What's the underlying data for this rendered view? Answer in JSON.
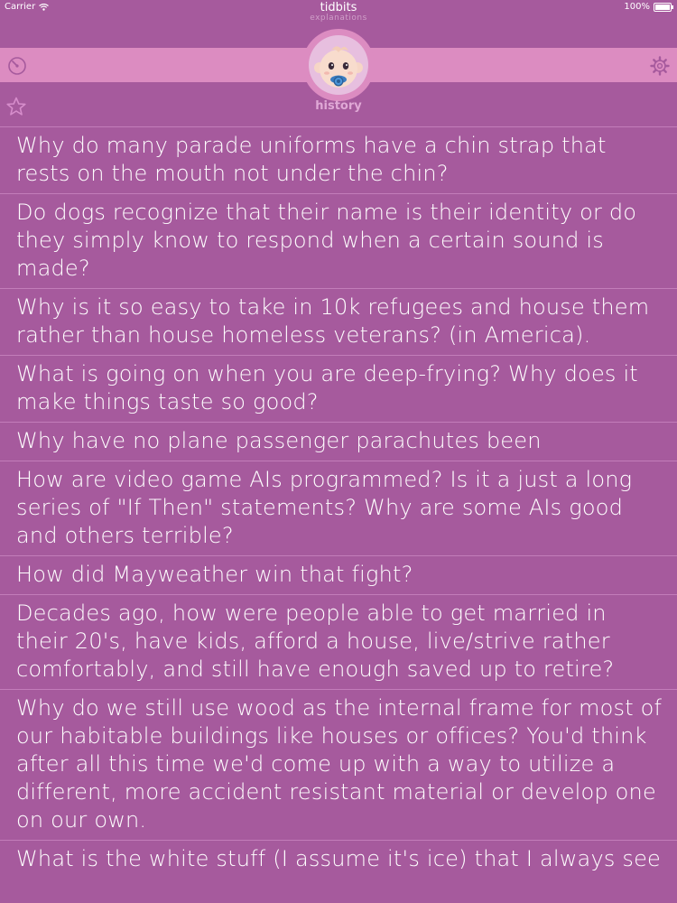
{
  "status_bar": {
    "carrier": "Carrier",
    "battery": "100%"
  },
  "app": {
    "title": "tidbits",
    "subtitle": "explanations"
  },
  "section": {
    "label": "history"
  },
  "questions": [
    "Why do many parade uniforms have a chin strap that rests on the mouth not under the chin?",
    "Do dogs recognize that their name is their identity or do they simply know to respond when a certain sound is made?",
    "Why is it so easy to take in 10k refugees and house them rather than house homeless veterans? (in America).",
    "What is going on when you are deep-frying? Why does it make things taste so good?",
    "Why have no plane passenger parachutes been",
    "How are video game AIs programmed? Is it a just a long series of \"If Then\" statements? Why are some AIs good and others terrible?",
    "How did Mayweather win that fight?",
    "Decades ago, how were people able to get married in their 20's, have kids, afford a house, live/strive rather comfortably, and still have enough saved up to retire?",
    "Why do we still use wood as the internal frame for most of our habitable buildings like houses or offices? You'd think after all this time we'd come up with a way to utilize a different, more accident resistant material or develop one on our own.",
    "What is the white stuff (I assume it's ice) that I always see"
  ],
  "icons": {
    "top_left": "dashboard-gauge-icon",
    "top_right": "gear-icon",
    "favorites": "star-icon",
    "avatar": "baby-face-icon"
  },
  "colors": {
    "background": "#a65a9d",
    "band": "#dc8cc1",
    "separator": "#c37dba",
    "history_text": "#e0a9d6"
  }
}
